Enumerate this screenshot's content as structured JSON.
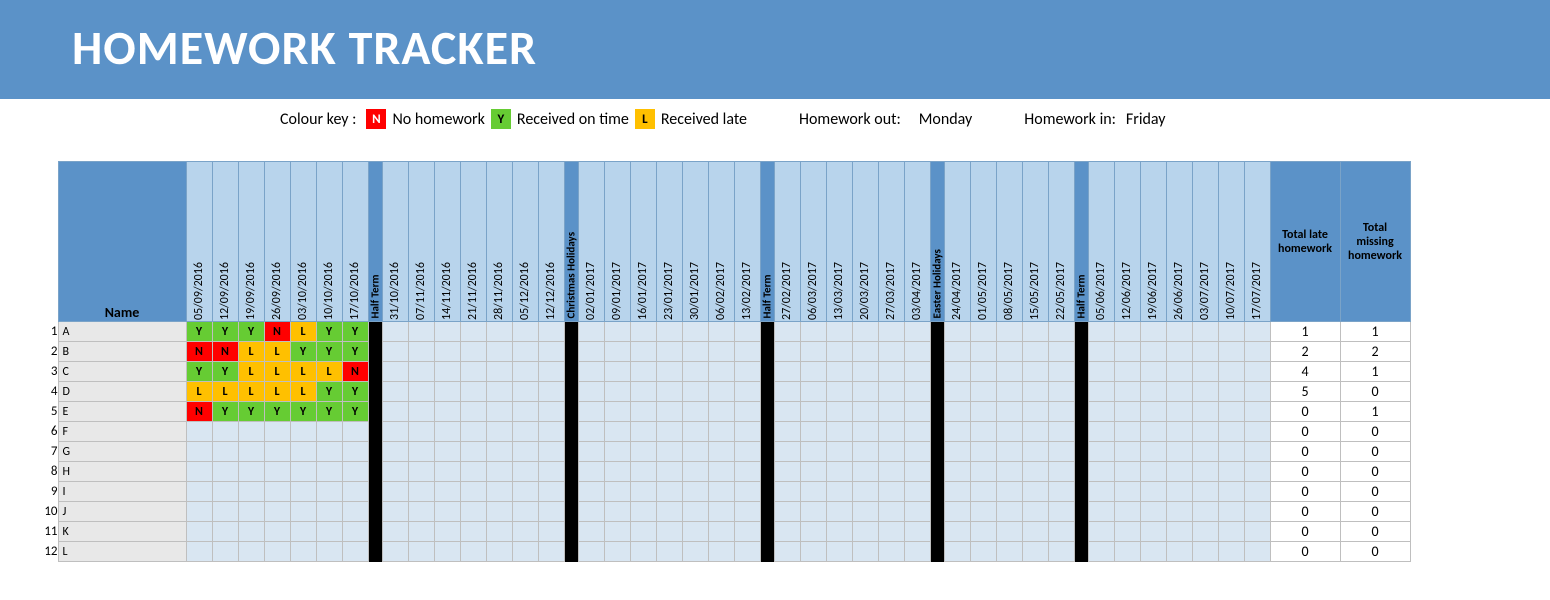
{
  "title": "HOMEWORK TRACKER",
  "legend": {
    "label": "Colour key :",
    "n_code": "N",
    "n_text": "No homework",
    "y_code": "Y",
    "y_text": "Received on time",
    "l_code": "L",
    "l_text": "Received late",
    "hw_out_label": "Homework out:",
    "hw_out_day": "Monday",
    "hw_in_label": "Homework in:",
    "hw_in_day": "Friday"
  },
  "headers": {
    "name": "Name",
    "total_late": "Total late homework",
    "total_missing": "Total missing homework"
  },
  "columns": [
    {
      "type": "date",
      "label": "05/09/2016"
    },
    {
      "type": "date",
      "label": "12/09/2016"
    },
    {
      "type": "date",
      "label": "19/09/2016"
    },
    {
      "type": "date",
      "label": "26/09/2016"
    },
    {
      "type": "date",
      "label": "03/10/2016"
    },
    {
      "type": "date",
      "label": "10/10/2016"
    },
    {
      "type": "date",
      "label": "17/10/2016"
    },
    {
      "type": "break",
      "label": "Half Term"
    },
    {
      "type": "date",
      "label": "31/10/2016"
    },
    {
      "type": "date",
      "label": "07/11/2016"
    },
    {
      "type": "date",
      "label": "14/11/2016"
    },
    {
      "type": "date",
      "label": "21/11/2016"
    },
    {
      "type": "date",
      "label": "28/11/2016"
    },
    {
      "type": "date",
      "label": "05/12/2016"
    },
    {
      "type": "date",
      "label": "12/12/2016"
    },
    {
      "type": "break",
      "label": "Christmas Holidays"
    },
    {
      "type": "date",
      "label": "02/01/2017"
    },
    {
      "type": "date",
      "label": "09/01/2017"
    },
    {
      "type": "date",
      "label": "16/01/2017"
    },
    {
      "type": "date",
      "label": "23/01/2017"
    },
    {
      "type": "date",
      "label": "30/01/2017"
    },
    {
      "type": "date",
      "label": "06/02/2017"
    },
    {
      "type": "date",
      "label": "13/02/2017"
    },
    {
      "type": "break",
      "label": "Half Term"
    },
    {
      "type": "date",
      "label": "27/02/2017"
    },
    {
      "type": "date",
      "label": "06/03/2017"
    },
    {
      "type": "date",
      "label": "13/03/2017"
    },
    {
      "type": "date",
      "label": "20/03/2017"
    },
    {
      "type": "date",
      "label": "27/03/2017"
    },
    {
      "type": "date",
      "label": "03/04/2017"
    },
    {
      "type": "break",
      "label": "Easter Holidays"
    },
    {
      "type": "date",
      "label": "24/04/2017"
    },
    {
      "type": "date",
      "label": "01/05/2017"
    },
    {
      "type": "date",
      "label": "08/05/2017"
    },
    {
      "type": "date",
      "label": "15/05/2017"
    },
    {
      "type": "date",
      "label": "22/05/2017"
    },
    {
      "type": "break",
      "label": "Half Term"
    },
    {
      "type": "date",
      "label": "05/06/2017"
    },
    {
      "type": "date",
      "label": "12/06/2017"
    },
    {
      "type": "date",
      "label": "19/06/2017"
    },
    {
      "type": "date",
      "label": "26/06/2017"
    },
    {
      "type": "date",
      "label": "03/07/2017"
    },
    {
      "type": "date",
      "label": "10/07/2017"
    },
    {
      "type": "date",
      "label": "17/07/2017"
    }
  ],
  "rows": [
    {
      "num": "1",
      "name": "A",
      "marks": [
        "Y",
        "Y",
        "Y",
        "N",
        "L",
        "Y",
        "Y"
      ],
      "late": "1",
      "missing": "1"
    },
    {
      "num": "2",
      "name": "B",
      "marks": [
        "N",
        "N",
        "L",
        "L",
        "Y",
        "Y",
        "Y"
      ],
      "late": "2",
      "missing": "2"
    },
    {
      "num": "3",
      "name": "C",
      "marks": [
        "Y",
        "Y",
        "L",
        "L",
        "L",
        "L",
        "N"
      ],
      "late": "4",
      "missing": "1"
    },
    {
      "num": "4",
      "name": "D",
      "marks": [
        "L",
        "L",
        "L",
        "L",
        "L",
        "Y",
        "Y"
      ],
      "late": "5",
      "missing": "0"
    },
    {
      "num": "5",
      "name": "E",
      "marks": [
        "N",
        "Y",
        "Y",
        "Y",
        "Y",
        "Y",
        "Y"
      ],
      "late": "0",
      "missing": "1"
    },
    {
      "num": "6",
      "name": "F",
      "marks": [],
      "late": "0",
      "missing": "0"
    },
    {
      "num": "7",
      "name": "G",
      "marks": [],
      "late": "0",
      "missing": "0"
    },
    {
      "num": "8",
      "name": "H",
      "marks": [],
      "late": "0",
      "missing": "0"
    },
    {
      "num": "9",
      "name": "I",
      "marks": [],
      "late": "0",
      "missing": "0"
    },
    {
      "num": "10",
      "name": "J",
      "marks": [],
      "late": "0",
      "missing": "0"
    },
    {
      "num": "11",
      "name": "K",
      "marks": [],
      "late": "0",
      "missing": "0"
    },
    {
      "num": "12",
      "name": "L",
      "marks": [],
      "late": "0",
      "missing": "0"
    }
  ]
}
